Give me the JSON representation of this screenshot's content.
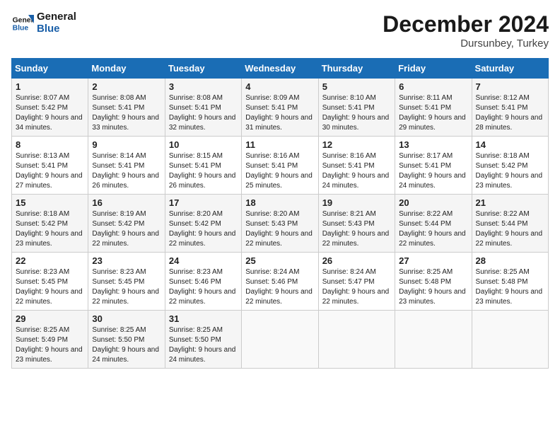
{
  "logo": {
    "line1": "General",
    "line2": "Blue"
  },
  "title": "December 2024",
  "subtitle": "Dursunbey, Turkey",
  "days_of_week": [
    "Sunday",
    "Monday",
    "Tuesday",
    "Wednesday",
    "Thursday",
    "Friday",
    "Saturday"
  ],
  "weeks": [
    [
      {
        "day": "1",
        "sunrise": "8:07 AM",
        "sunset": "5:42 PM",
        "daylight": "9 hours and 34 minutes."
      },
      {
        "day": "2",
        "sunrise": "8:08 AM",
        "sunset": "5:41 PM",
        "daylight": "9 hours and 33 minutes."
      },
      {
        "day": "3",
        "sunrise": "8:08 AM",
        "sunset": "5:41 PM",
        "daylight": "9 hours and 32 minutes."
      },
      {
        "day": "4",
        "sunrise": "8:09 AM",
        "sunset": "5:41 PM",
        "daylight": "9 hours and 31 minutes."
      },
      {
        "day": "5",
        "sunrise": "8:10 AM",
        "sunset": "5:41 PM",
        "daylight": "9 hours and 30 minutes."
      },
      {
        "day": "6",
        "sunrise": "8:11 AM",
        "sunset": "5:41 PM",
        "daylight": "9 hours and 29 minutes."
      },
      {
        "day": "7",
        "sunrise": "8:12 AM",
        "sunset": "5:41 PM",
        "daylight": "9 hours and 28 minutes."
      }
    ],
    [
      {
        "day": "8",
        "sunrise": "8:13 AM",
        "sunset": "5:41 PM",
        "daylight": "9 hours and 27 minutes."
      },
      {
        "day": "9",
        "sunrise": "8:14 AM",
        "sunset": "5:41 PM",
        "daylight": "9 hours and 26 minutes."
      },
      {
        "day": "10",
        "sunrise": "8:15 AM",
        "sunset": "5:41 PM",
        "daylight": "9 hours and 26 minutes."
      },
      {
        "day": "11",
        "sunrise": "8:16 AM",
        "sunset": "5:41 PM",
        "daylight": "9 hours and 25 minutes."
      },
      {
        "day": "12",
        "sunrise": "8:16 AM",
        "sunset": "5:41 PM",
        "daylight": "9 hours and 24 minutes."
      },
      {
        "day": "13",
        "sunrise": "8:17 AM",
        "sunset": "5:41 PM",
        "daylight": "9 hours and 24 minutes."
      },
      {
        "day": "14",
        "sunrise": "8:18 AM",
        "sunset": "5:42 PM",
        "daylight": "9 hours and 23 minutes."
      }
    ],
    [
      {
        "day": "15",
        "sunrise": "8:18 AM",
        "sunset": "5:42 PM",
        "daylight": "9 hours and 23 minutes."
      },
      {
        "day": "16",
        "sunrise": "8:19 AM",
        "sunset": "5:42 PM",
        "daylight": "9 hours and 22 minutes."
      },
      {
        "day": "17",
        "sunrise": "8:20 AM",
        "sunset": "5:42 PM",
        "daylight": "9 hours and 22 minutes."
      },
      {
        "day": "18",
        "sunrise": "8:20 AM",
        "sunset": "5:43 PM",
        "daylight": "9 hours and 22 minutes."
      },
      {
        "day": "19",
        "sunrise": "8:21 AM",
        "sunset": "5:43 PM",
        "daylight": "9 hours and 22 minutes."
      },
      {
        "day": "20",
        "sunrise": "8:22 AM",
        "sunset": "5:44 PM",
        "daylight": "9 hours and 22 minutes."
      },
      {
        "day": "21",
        "sunrise": "8:22 AM",
        "sunset": "5:44 PM",
        "daylight": "9 hours and 22 minutes."
      }
    ],
    [
      {
        "day": "22",
        "sunrise": "8:23 AM",
        "sunset": "5:45 PM",
        "daylight": "9 hours and 22 minutes."
      },
      {
        "day": "23",
        "sunrise": "8:23 AM",
        "sunset": "5:45 PM",
        "daylight": "9 hours and 22 minutes."
      },
      {
        "day": "24",
        "sunrise": "8:23 AM",
        "sunset": "5:46 PM",
        "daylight": "9 hours and 22 minutes."
      },
      {
        "day": "25",
        "sunrise": "8:24 AM",
        "sunset": "5:46 PM",
        "daylight": "9 hours and 22 minutes."
      },
      {
        "day": "26",
        "sunrise": "8:24 AM",
        "sunset": "5:47 PM",
        "daylight": "9 hours and 22 minutes."
      },
      {
        "day": "27",
        "sunrise": "8:25 AM",
        "sunset": "5:48 PM",
        "daylight": "9 hours and 23 minutes."
      },
      {
        "day": "28",
        "sunrise": "8:25 AM",
        "sunset": "5:48 PM",
        "daylight": "9 hours and 23 minutes."
      }
    ],
    [
      {
        "day": "29",
        "sunrise": "8:25 AM",
        "sunset": "5:49 PM",
        "daylight": "9 hours and 23 minutes."
      },
      {
        "day": "30",
        "sunrise": "8:25 AM",
        "sunset": "5:50 PM",
        "daylight": "9 hours and 24 minutes."
      },
      {
        "day": "31",
        "sunrise": "8:25 AM",
        "sunset": "5:50 PM",
        "daylight": "9 hours and 24 minutes."
      },
      null,
      null,
      null,
      null
    ]
  ]
}
